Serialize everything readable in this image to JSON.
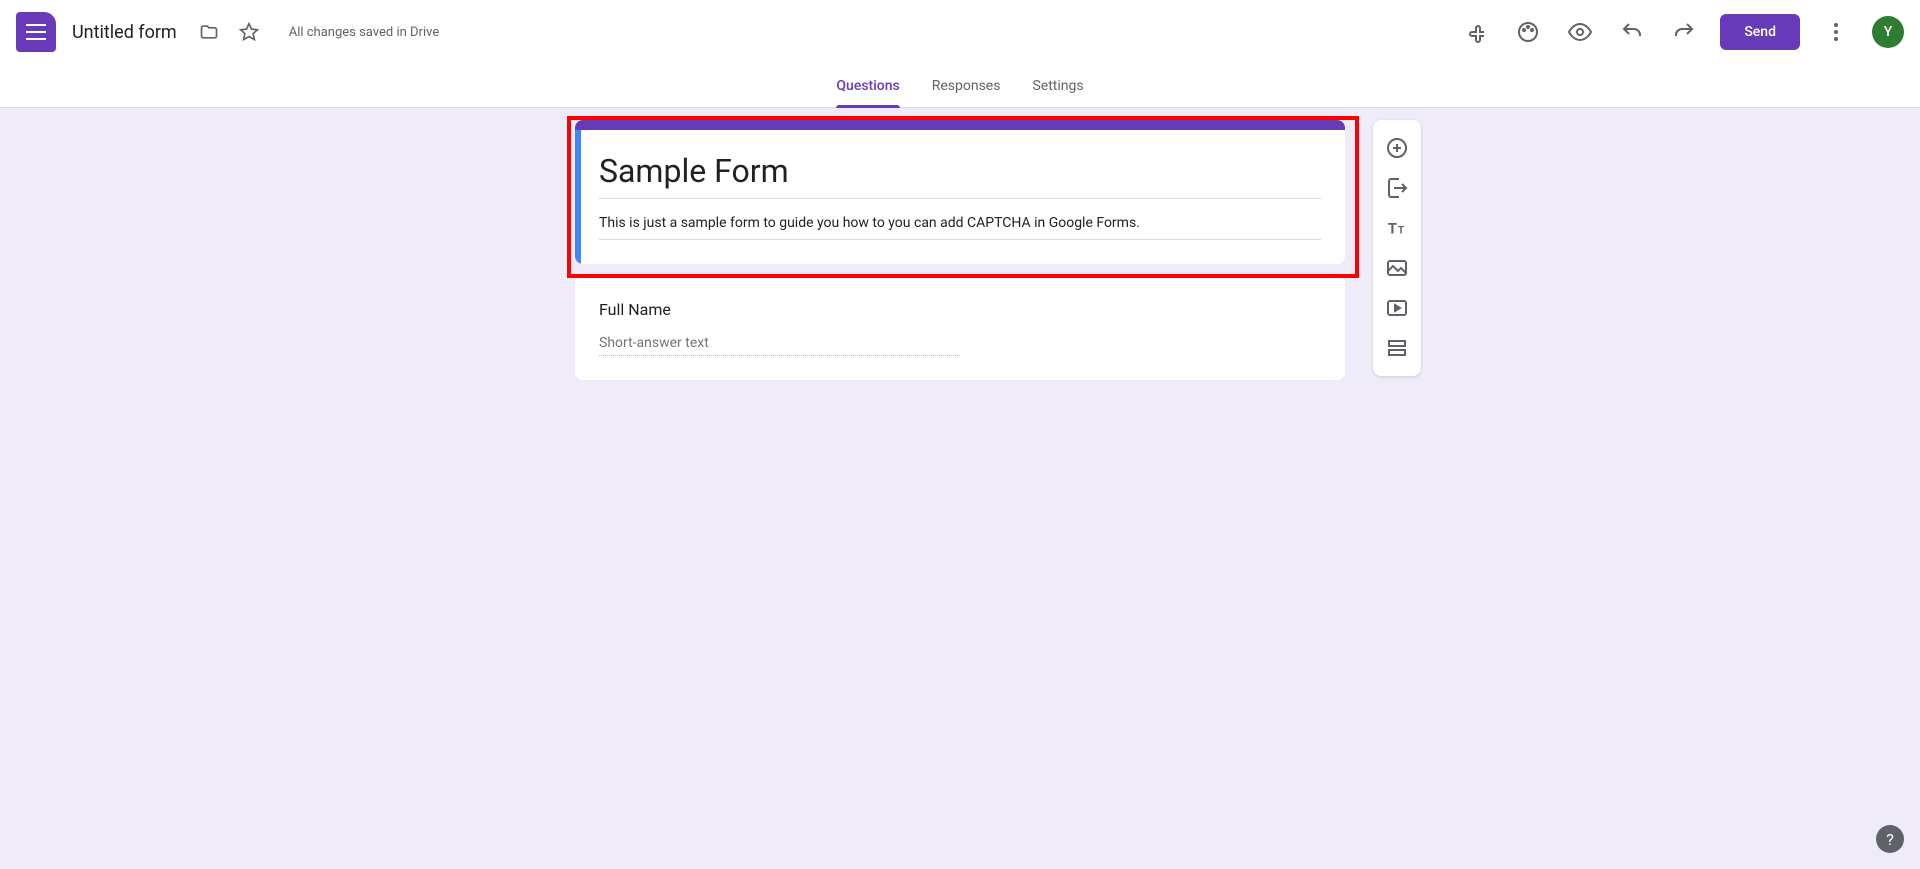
{
  "header": {
    "form_name": "Untitled form",
    "save_status": "All changes saved in Drive",
    "send_label": "Send",
    "avatar_letter": "Y"
  },
  "tabs": {
    "questions": "Questions",
    "responses": "Responses",
    "settings": "Settings"
  },
  "form": {
    "title": "Sample Form",
    "description": "This is just a sample form to guide you how to you can add CAPTCHA in Google Forms."
  },
  "question": {
    "title": "Full Name",
    "placeholder": "Short-answer text"
  },
  "help": "?"
}
